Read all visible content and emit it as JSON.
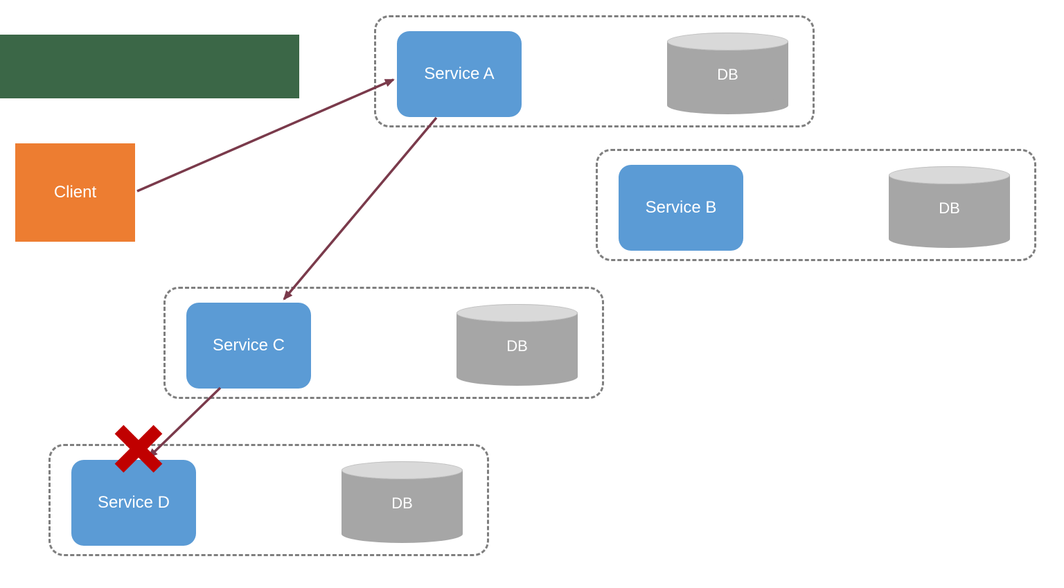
{
  "diagram": {
    "client_label": "Client",
    "groups": {
      "a": {
        "service_label": "Service A",
        "db_label": "DB"
      },
      "b": {
        "service_label": "Service B",
        "db_label": "DB"
      },
      "c": {
        "service_label": "Service C",
        "db_label": "DB"
      },
      "d": {
        "service_label": "Service D",
        "db_label": "DB"
      }
    },
    "edges": [
      {
        "from": "client",
        "to": "service-a",
        "broken": false
      },
      {
        "from": "service-a",
        "to": "service-c",
        "broken": false
      },
      {
        "from": "service-c",
        "to": "service-d",
        "broken": true
      }
    ],
    "colors": {
      "service_fill": "#5b9bd5",
      "client_fill": "#ed7d31",
      "group_border": "#7f7f7f",
      "arrow": "#7a3a4b",
      "error": "#c00000",
      "decor_green": "#3b6747",
      "db_fill": "#a6a6a6",
      "db_lid": "#d9d9d9"
    }
  }
}
